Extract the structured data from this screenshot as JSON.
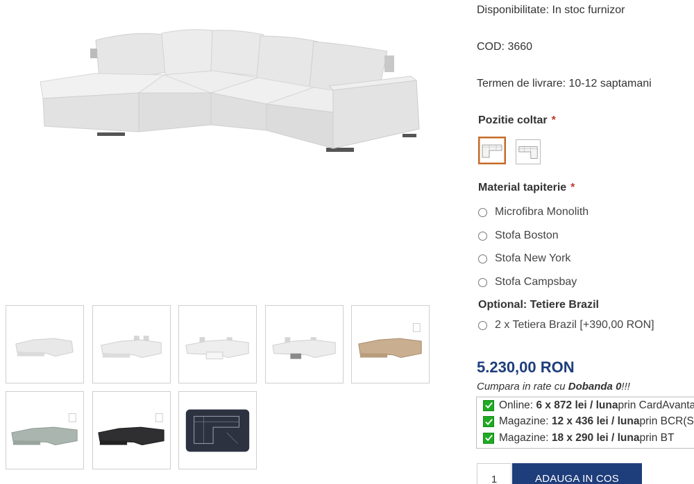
{
  "product_info": {
    "availability": "Disponibilitate: In stoc furnizor",
    "code": "COD: 3660",
    "delivery": "Termen de livrare: 10-12 saptamani"
  },
  "corner_position": {
    "title": "Pozitie coltar",
    "required_mark": "*",
    "options": [
      {
        "name": "left-corner-option",
        "selected": true
      },
      {
        "name": "right-corner-option",
        "selected": false
      }
    ]
  },
  "upholstery": {
    "title": "Material tapiterie",
    "required_mark": "*",
    "options": [
      "Microfibra Monolith",
      "Stofa Boston",
      "Stofa New York",
      "Stofa Campsbay"
    ]
  },
  "optional": {
    "title": "Optional: Tetiere Brazil",
    "options": [
      "2 x Tetiera Brazil [+390,00 RON]"
    ]
  },
  "price": {
    "value": "5.230,00 RON",
    "installments_intro_prefix": "Cumpara in rate cu ",
    "installments_intro_bold": "Dobanda 0",
    "installments_intro_suffix": "!!!",
    "rates": [
      {
        "prefix": "Online: ",
        "amount": "6 x 872 lei / luna",
        "suffix": " prin CardAvantaj"
      },
      {
        "prefix": "Magazine: ",
        "amount": "12 x 436 lei / luna",
        "suffix": " prin BCR(Star Bt)"
      },
      {
        "prefix": "Magazine: ",
        "amount": "18 x 290 lei / luna",
        "suffix": " prin BT"
      }
    ]
  },
  "cart": {
    "quantity": "1",
    "add_label": "ADAUGA IN COS"
  },
  "gallery": {
    "thumbnails": [
      {
        "color": "#e8e8e8"
      },
      {
        "color": "#ececec"
      },
      {
        "color": "#eeeeee"
      },
      {
        "color": "#ececec"
      },
      {
        "color": "#c9ae8f"
      },
      {
        "color": "#a9b5ae"
      },
      {
        "color": "#2f2f31"
      },
      {
        "color": "#2c3240"
      }
    ]
  },
  "colors": {
    "accent": "#1e3d7b",
    "selected_border": "#c46a2a",
    "check": "#1faa23",
    "required": "#c0392b"
  }
}
